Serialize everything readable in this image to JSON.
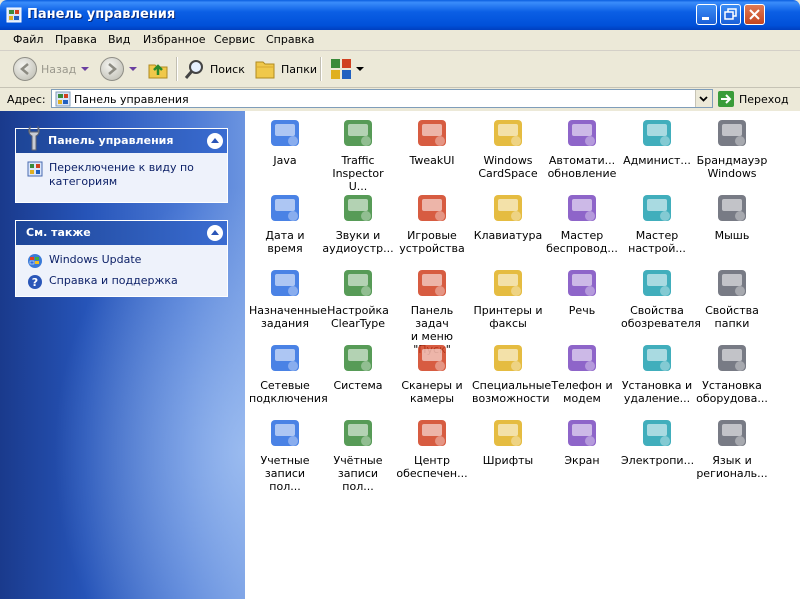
{
  "window": {
    "title": "Панель управления"
  },
  "menu": [
    "Файл",
    "Правка",
    "Вид",
    "Избранное",
    "Сервис",
    "Справка"
  ],
  "toolbar": {
    "back": "Назад",
    "search": "Поиск",
    "folders": "Папки"
  },
  "address": {
    "label": "Адрес:",
    "value": "Панель управления",
    "go": "Переход"
  },
  "tasks": {
    "control_panel": {
      "title": "Панель управления",
      "link": "Переключение к виду по категориям"
    },
    "see_also": {
      "title": "См. также",
      "links": [
        "Windows Update",
        "Справка и поддержка"
      ]
    }
  },
  "items": [
    {
      "label": "Java",
      "icon": "java-icon"
    },
    {
      "label": "Traffic\nInspector U...",
      "icon": "traffic-inspector-icon"
    },
    {
      "label": "TweakUI",
      "icon": "tweakui-icon"
    },
    {
      "label": "Windows\nCardSpace",
      "icon": "cardspace-icon"
    },
    {
      "label": "Автомати...\nобновление",
      "icon": "automatic-updates-icon"
    },
    {
      "label": "Админист...",
      "icon": "admin-tools-icon"
    },
    {
      "label": "Брандмауэр\nWindows",
      "icon": "firewall-icon"
    },
    {
      "label": "Дата и время",
      "icon": "date-time-icon"
    },
    {
      "label": "Звуки и\nаудиоустр...",
      "icon": "sounds-icon"
    },
    {
      "label": "Игровые\nустройства",
      "icon": "game-controllers-icon"
    },
    {
      "label": "Клавиатура",
      "icon": "keyboard-icon"
    },
    {
      "label": "Мастер\nбеспровод...",
      "icon": "wireless-wizard-icon"
    },
    {
      "label": "Мастер\nнастрой...",
      "icon": "network-wizard-icon"
    },
    {
      "label": "Мышь",
      "icon": "mouse-icon"
    },
    {
      "label": "Назначенные\nзадания",
      "icon": "scheduled-tasks-icon"
    },
    {
      "label": "Настройка\nClearType",
      "icon": "cleartype-icon"
    },
    {
      "label": "Панель задач\nи меню \"Пуск\"",
      "icon": "taskbar-icon"
    },
    {
      "label": "Принтеры и\nфаксы",
      "icon": "printers-icon"
    },
    {
      "label": "Речь",
      "icon": "speech-icon"
    },
    {
      "label": "Свойства\nобозревателя",
      "icon": "internet-options-icon"
    },
    {
      "label": "Свойства\nпапки",
      "icon": "folder-options-icon"
    },
    {
      "label": "Сетевые\nподключения",
      "icon": "network-connections-icon"
    },
    {
      "label": "Система",
      "icon": "system-icon"
    },
    {
      "label": "Сканеры и\nкамеры",
      "icon": "scanners-icon"
    },
    {
      "label": "Специальные\nвозможности",
      "icon": "accessibility-icon"
    },
    {
      "label": "Телефон и\nмодем",
      "icon": "phone-modem-icon"
    },
    {
      "label": "Установка и\nудаление...",
      "icon": "add-remove-icon"
    },
    {
      "label": "Установка\nоборудова...",
      "icon": "add-hardware-icon"
    },
    {
      "label": "Учетные\nзаписи пол...",
      "icon": "user-accounts-icon"
    },
    {
      "label": "Учётные\nзаписи пол...",
      "icon": "user-accounts-lock-icon"
    },
    {
      "label": "Центр\nобеспечен...",
      "icon": "security-center-icon"
    },
    {
      "label": "Шрифты",
      "icon": "fonts-icon"
    },
    {
      "label": "Экран",
      "icon": "display-icon"
    },
    {
      "label": "Электропи...",
      "icon": "power-options-icon"
    },
    {
      "label": "Язык и\nрегиональ...",
      "icon": "regional-icon"
    }
  ]
}
